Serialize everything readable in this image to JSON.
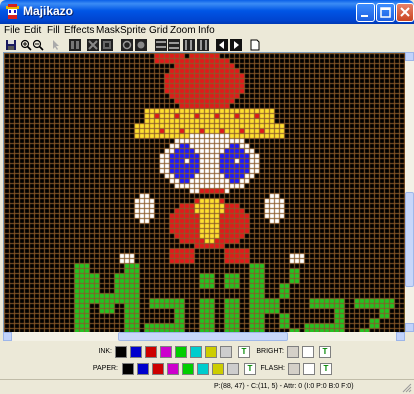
{
  "window": {
    "title": "Majikazo"
  },
  "menu": [
    {
      "name": "file",
      "label": "File"
    },
    {
      "name": "edit",
      "label": "Edit"
    },
    {
      "name": "fill",
      "label": "Fill"
    },
    {
      "name": "effects",
      "label": "Effects"
    },
    {
      "name": "mask",
      "label": "Mask"
    },
    {
      "name": "sprite",
      "label": "Sprite"
    },
    {
      "name": "grid",
      "label": "Grid"
    },
    {
      "name": "zoom",
      "label": "Zoom"
    },
    {
      "name": "info",
      "label": "Info"
    }
  ],
  "toolbar": [
    {
      "name": "save-icon"
    },
    {
      "name": "zoom-in-icon"
    },
    {
      "name": "zoom-out-icon"
    },
    {
      "name": "pointer-icon"
    },
    {
      "name": "mirror-horizontal-icon"
    },
    {
      "name": "mirror-vertical-icon"
    },
    {
      "name": "invert-icon"
    },
    {
      "name": "rotate-left-icon"
    },
    {
      "name": "rotate-right-icon"
    },
    {
      "name": "shift-up-icon"
    },
    {
      "name": "shift-down-icon"
    },
    {
      "name": "shift-left-icon"
    },
    {
      "name": "shift-right-icon"
    },
    {
      "name": "previous-frame-icon"
    },
    {
      "name": "next-frame-icon"
    },
    {
      "name": "new-page-icon"
    }
  ],
  "artwork": {
    "text": "MajiKazo",
    "grid_color": "#8a5a2a",
    "background": "#000000"
  },
  "palette": {
    "ink_label": "INK:",
    "paper_label": "PAPER:",
    "bright_label": "BRIGHT:",
    "flash_label": "FLASH:",
    "colors": [
      "#000000",
      "#0000cd",
      "#cd0000",
      "#cd00cd",
      "#00cd00",
      "#00cdcd",
      "#cdcd00",
      "#cdcdcd"
    ],
    "transparent_symbol": "T"
  },
  "status": {
    "text": "P:(88, 47) - C:(11, 5) - Attr: 0 (I:0 P:0 B:0 F:0)"
  }
}
